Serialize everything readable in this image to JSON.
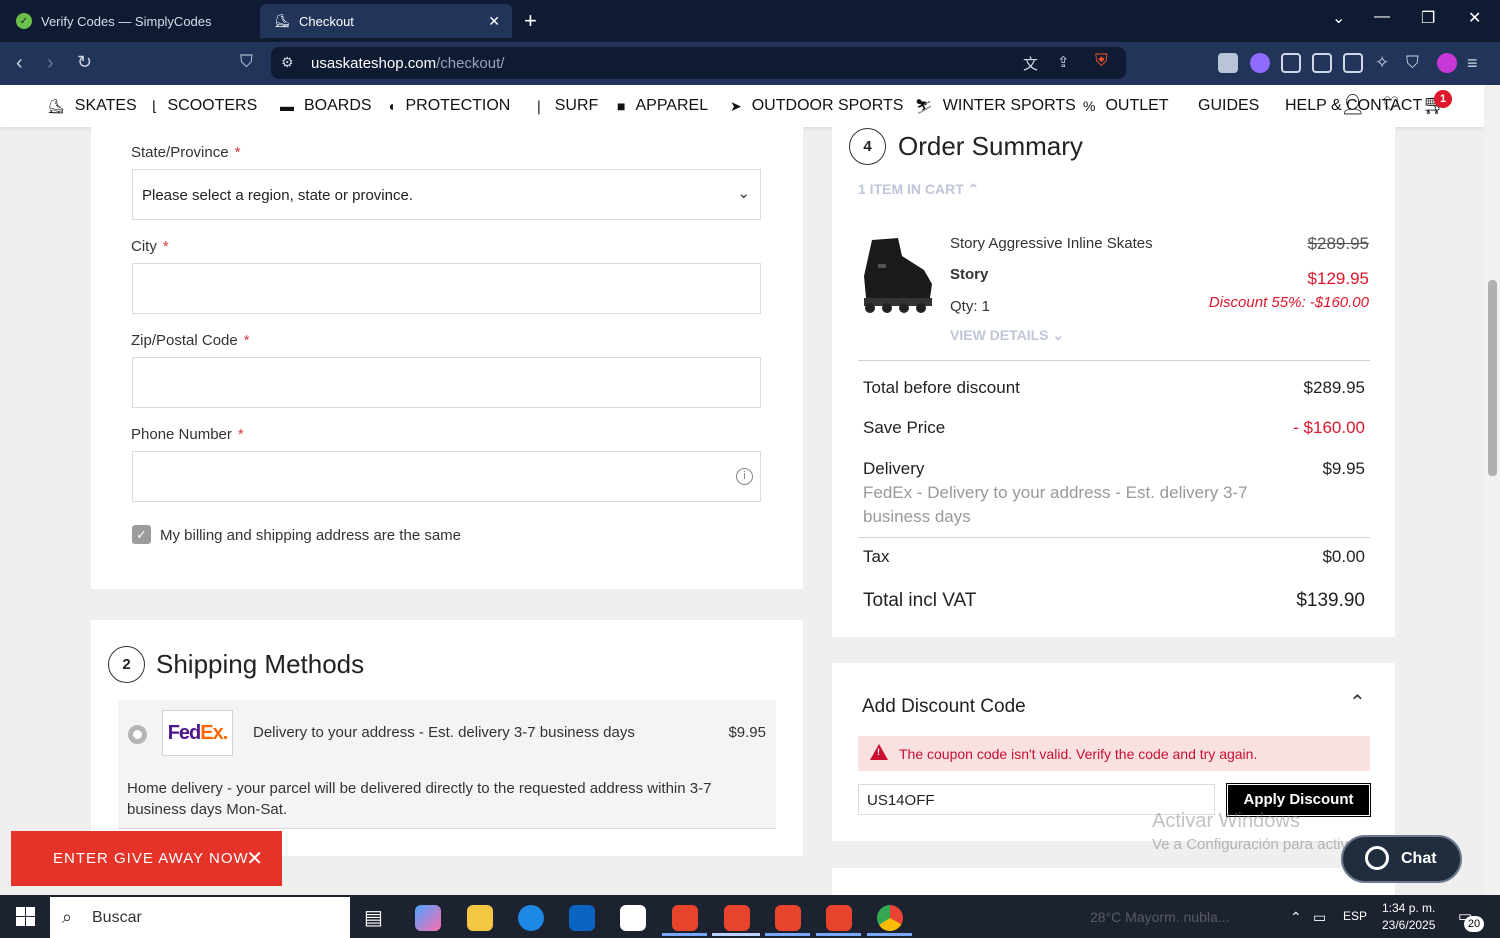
{
  "browser": {
    "tabs": [
      {
        "title": "Verify Codes — SimplyCodes",
        "active": false
      },
      {
        "title": "Checkout",
        "active": true
      }
    ],
    "url_domain": "usaskateshop.com",
    "url_path": "/checkout/",
    "shield_count": "3"
  },
  "site_nav": {
    "items": [
      {
        "label": "SKATES",
        "icon": "skate-icon"
      },
      {
        "label": "SCOOTERS",
        "icon": "scooter-icon"
      },
      {
        "label": "BOARDS",
        "icon": "board-icon"
      },
      {
        "label": "PROTECTION",
        "icon": "helmet-icon"
      },
      {
        "label": "SURF",
        "icon": "surfboard-icon"
      },
      {
        "label": "APPAREL",
        "icon": "hoodie-icon"
      },
      {
        "label": "OUTDOOR SPORTS",
        "icon": "outdoor-icon"
      },
      {
        "label": "WINTER SPORTS",
        "icon": "ski-icon"
      },
      {
        "label": "OUTLET",
        "icon": "percent-icon"
      },
      {
        "label": "GUIDES"
      },
      {
        "label": "HELP & CONTACT"
      }
    ],
    "cart_count": "1"
  },
  "address_form": {
    "state_label": "State/Province",
    "state_value": "Please select a region, state or province.",
    "city_label": "City",
    "city_value": "",
    "zip_label": "Zip/Postal Code",
    "zip_value": "",
    "phone_label": "Phone Number",
    "phone_value": "",
    "required_mark": "*",
    "same_address_label": "My billing and shipping address are the same",
    "same_address_checked": true
  },
  "shipping": {
    "step": "2",
    "title": "Shipping Methods",
    "method_name": "Delivery to your address - Est. delivery 3-7 business days",
    "price": "$9.95",
    "description": "Home delivery - your parcel will be delivered directly to the requested address within 3-7 business days Mon-Sat.",
    "carrier_logo_fe": "Fed",
    "carrier_logo_ex": "Ex",
    "carrier_logo_dot": "."
  },
  "giveaway": {
    "label": "ENTER GIVE AWAY NOW"
  },
  "order_summary": {
    "step": "4",
    "title": "Order Summary",
    "items_in_cart": "1 ITEM IN CART",
    "product_name": "Story Aggressive Inline Skates",
    "brand": "Story",
    "qty": "Qty: 1",
    "view_details": "VIEW DETAILS",
    "old_price": "$289.95",
    "new_price": "$129.95",
    "discount_note": "Discount 55%: -$160.00",
    "rows": {
      "total_before_label": "Total before discount",
      "total_before_value": "$289.95",
      "save_label": "Save Price",
      "save_value": "- $160.00",
      "delivery_label": "Delivery",
      "delivery_value": "$9.95",
      "delivery_desc": "FedEx - Delivery to your address - Est. delivery 3-7 business days",
      "tax_label": "Tax",
      "tax_value": "$0.00",
      "total_label": "Total incl VAT",
      "total_value": "$139.90"
    }
  },
  "discount": {
    "title": "Add Discount Code",
    "error": "The coupon code isn't valid. Verify the code and try again.",
    "code_value": "US14OFF",
    "apply_label": "Apply Discount"
  },
  "watermark": {
    "line1": "Activar Windows",
    "line2": "Ve a Configuración para activar Windows."
  },
  "chat": {
    "label": "Chat"
  },
  "taskbar": {
    "search_placeholder": "Buscar",
    "weather": "28°C  Mayorm. nubla...",
    "lang": "ESP",
    "time": "1:34 p. m.",
    "date": "23/6/2025",
    "notifications": "20"
  },
  "colors": {
    "accent_red": "#e0162b",
    "error_text": "#c8102e",
    "giveaway_bg": "#e5332a",
    "browser_bg": "#0f1b33"
  }
}
